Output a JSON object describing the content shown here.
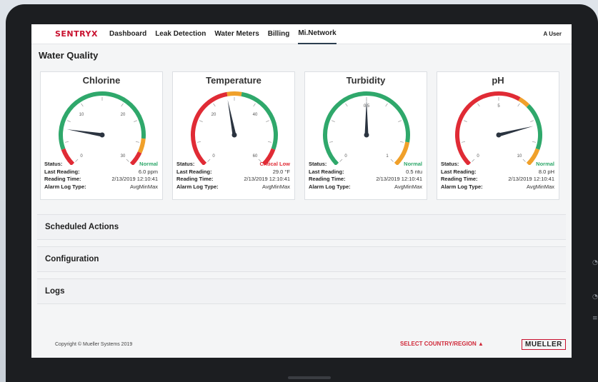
{
  "nav": {
    "logo": "SENTRYX",
    "items": [
      "Dashboard",
      "Leak Detection",
      "Water Meters",
      "Billing",
      "Mi.Network"
    ],
    "user": "A User"
  },
  "section_title": "Water Quality",
  "labels": {
    "status": "Status:",
    "last_reading": "Last Reading:",
    "reading_time": "Reading Time:",
    "alarm_log_type": "Alarm Log Type:"
  },
  "gauges": [
    {
      "title": "Chlorine",
      "status": "Normal",
      "last_reading": "6.0 ppm",
      "reading_time": "2/13/2019 12:10:41",
      "alarm_log_type": "AvgMinMax",
      "ticks": [
        "0",
        "10",
        "20",
        "30"
      ],
      "needle_fraction": 0.2,
      "status_color": "#2fa86b"
    },
    {
      "title": "Temperature",
      "status": "Critical Low",
      "last_reading": "29.0 °F",
      "reading_time": "2/13/2019 12:10:41",
      "alarm_log_type": "AvgMinMax",
      "ticks": [
        "0",
        "20",
        "40",
        "60"
      ],
      "needle_fraction": 0.46,
      "status_color": "#e02b35"
    },
    {
      "title": "Turbidity",
      "status": "Normal",
      "last_reading": "0.5 ntu",
      "reading_time": "2/13/2019 12:10:41",
      "alarm_log_type": "AvgMinMax",
      "ticks": [
        "0",
        "0.5",
        "1"
      ],
      "needle_fraction": 0.5,
      "status_color": "#2fa86b"
    },
    {
      "title": "pH",
      "status": "Normal",
      "last_reading": "8.0 pH",
      "reading_time": "2/13/2019 12:10:41",
      "alarm_log_type": "AvgMinMax",
      "ticks": [
        "0",
        "5",
        "10"
      ],
      "needle_fraction": 0.78,
      "status_color": "#2fa86b"
    }
  ],
  "panels": [
    "Scheduled Actions",
    "Configuration",
    "Logs"
  ],
  "footer": {
    "copyright": "Copyright © Mueller Systems 2019",
    "region": "SELECT COUNTRY/REGION ▲",
    "brand": "MUELLER"
  },
  "colors": {
    "green": "#2fa86b",
    "orange": "#f0a02a",
    "red": "#e02b35",
    "accent": "#c8102e"
  }
}
